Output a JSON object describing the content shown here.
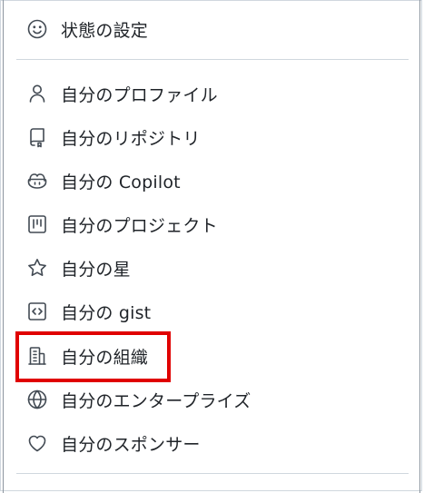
{
  "menu": {
    "status_item": {
      "label": "状態の設定",
      "icon": "smiley-icon"
    },
    "items": [
      {
        "label": "自分のプロファイル",
        "icon": "person-icon"
      },
      {
        "label": "自分のリポジトリ",
        "icon": "repo-icon"
      },
      {
        "label": "自分の Copilot",
        "icon": "copilot-icon"
      },
      {
        "label": "自分のプロジェクト",
        "icon": "project-icon"
      },
      {
        "label": "自分の星",
        "icon": "star-icon"
      },
      {
        "label": "自分の gist",
        "icon": "code-square-icon"
      },
      {
        "label": "自分の組織",
        "icon": "organization-icon"
      },
      {
        "label": "自分のエンタープライズ",
        "icon": "globe-icon"
      },
      {
        "label": "自分のスポンサー",
        "icon": "heart-icon"
      }
    ]
  },
  "colors": {
    "highlight": "#e00000",
    "text": "#1f2328",
    "icon": "#424a53",
    "divider": "#d0d7de"
  }
}
